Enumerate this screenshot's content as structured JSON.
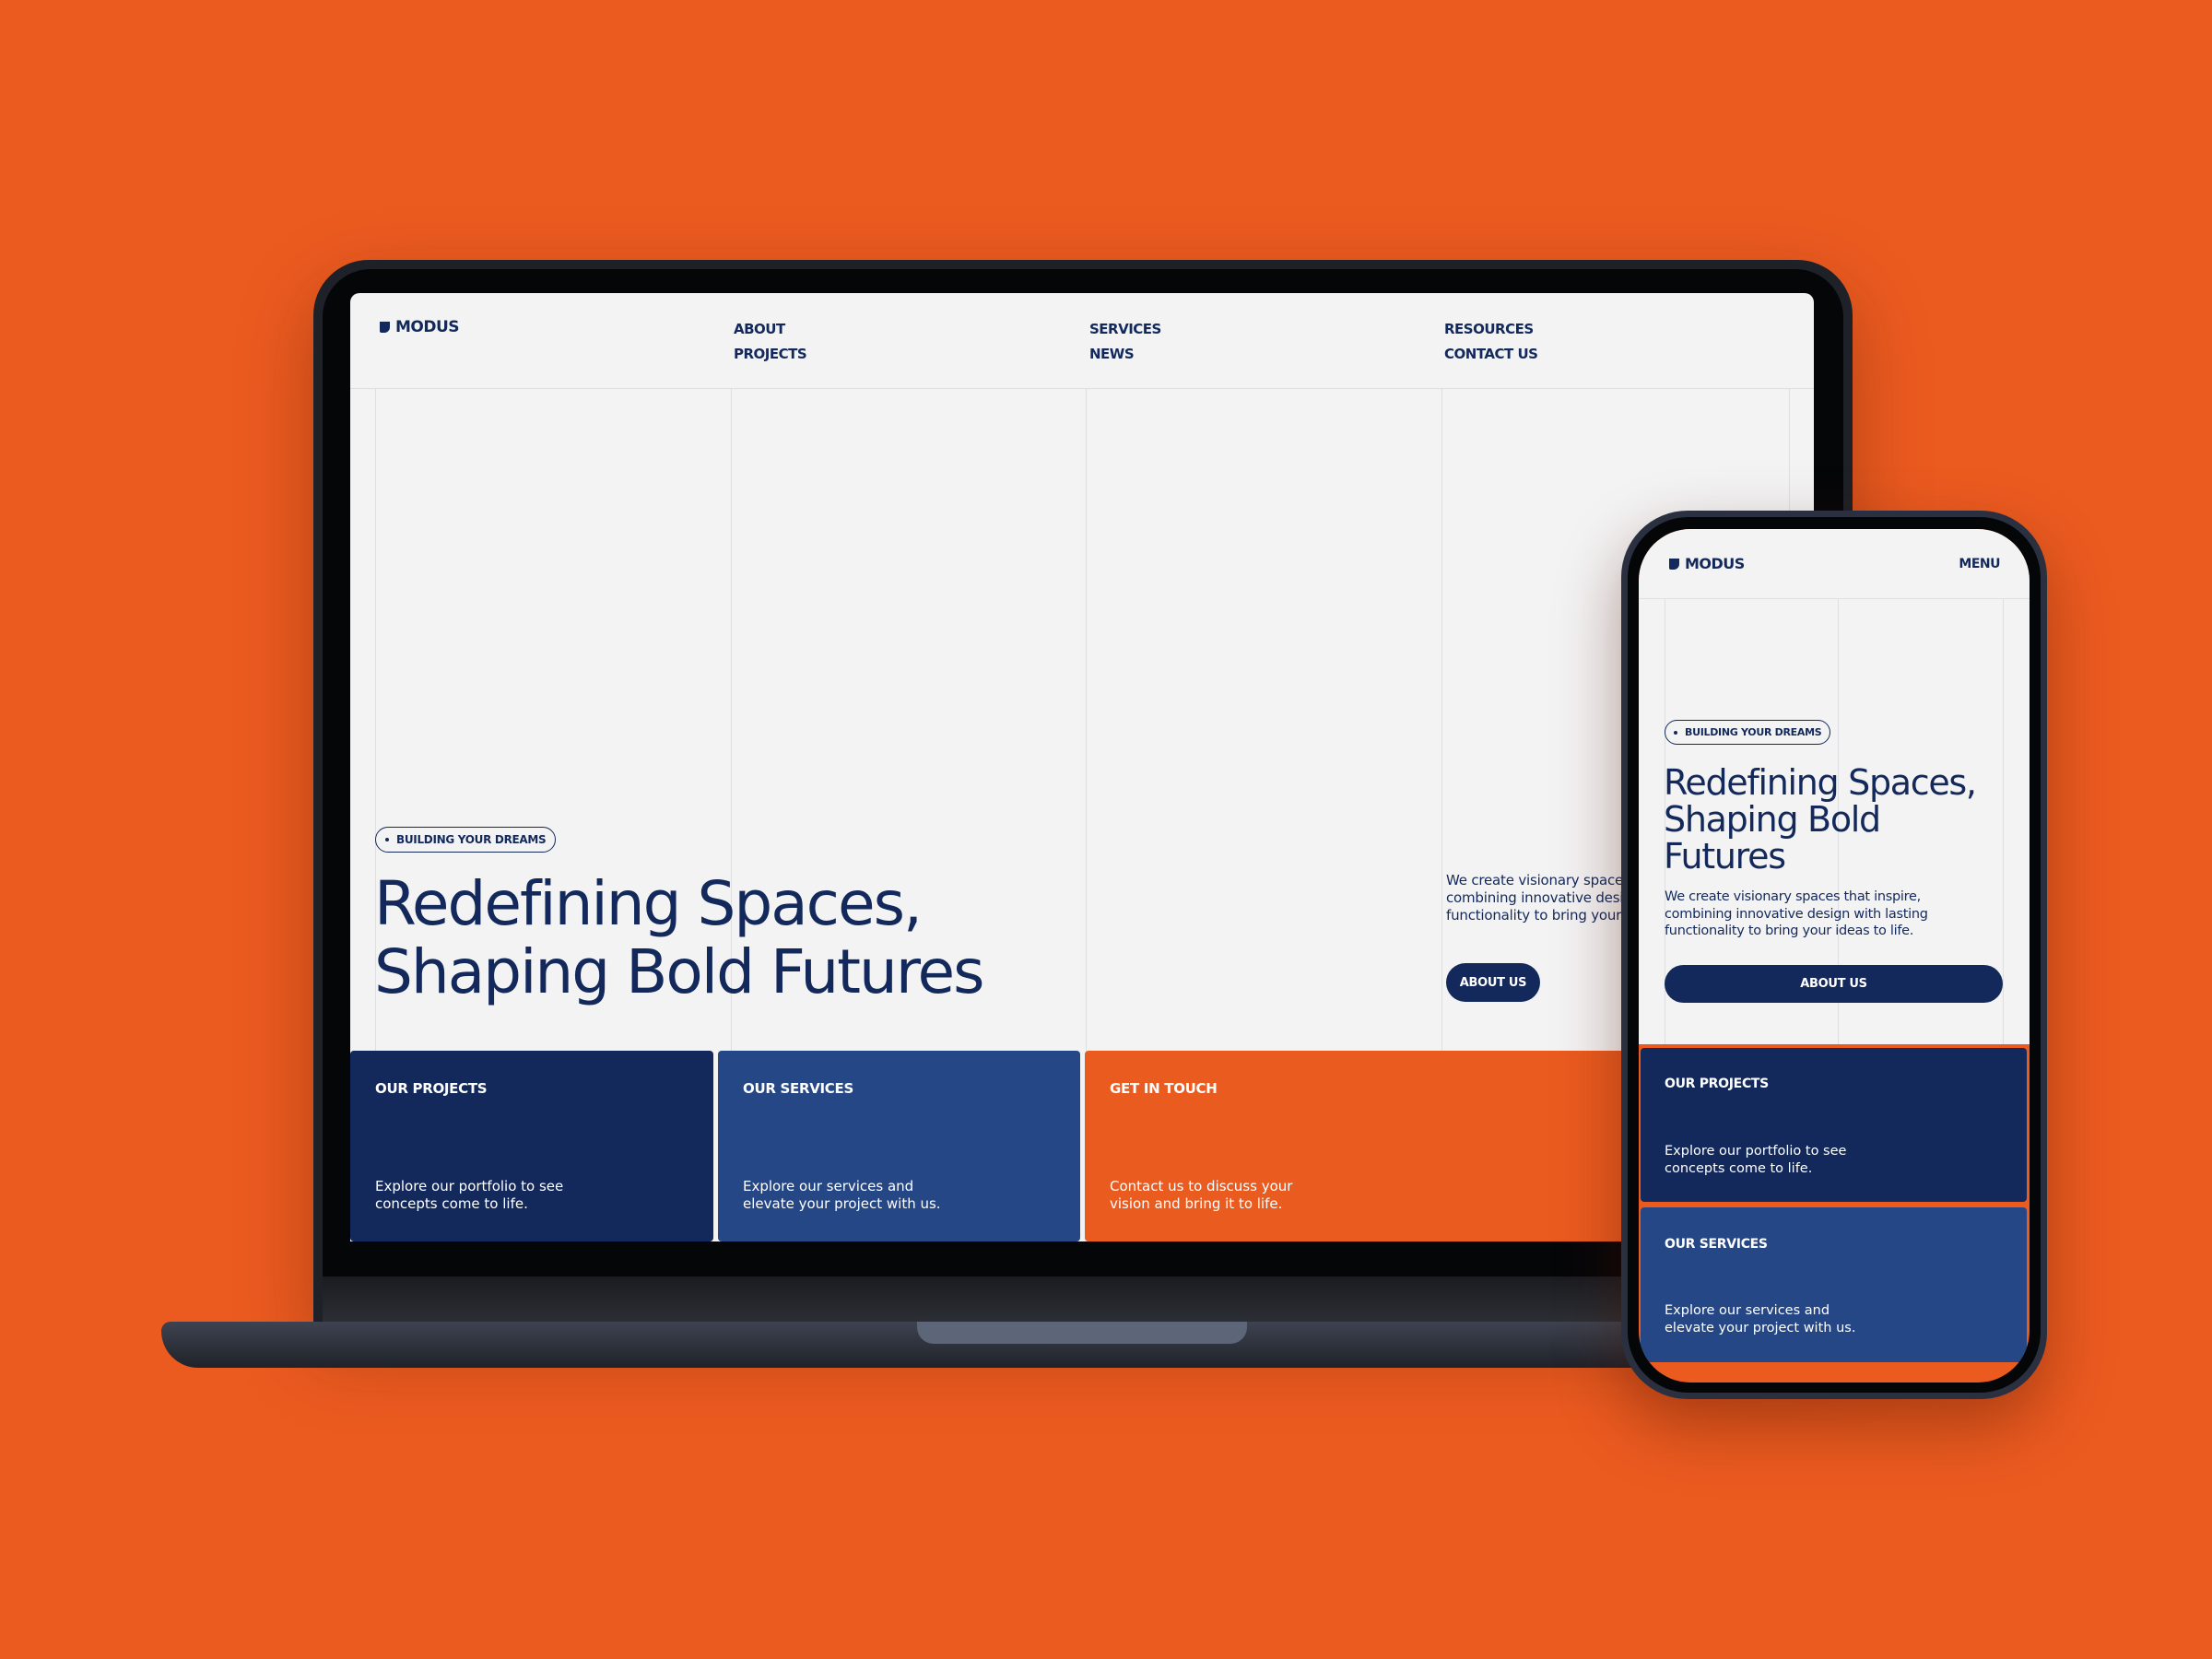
{
  "colors": {
    "background": "#eb5b20",
    "navy": "#13295c",
    "blue": "#264785",
    "orange": "#ea5b1f",
    "surface": "#f3f3f3"
  },
  "brand": {
    "name": "MODUS",
    "icon": "shield-logo-icon"
  },
  "desktop": {
    "nav": [
      {
        "label": "ABOUT"
      },
      {
        "label": "PROJECTS"
      },
      {
        "label": "SERVICES"
      },
      {
        "label": "NEWS"
      },
      {
        "label": "RESOURCES"
      },
      {
        "label": "CONTACT US"
      }
    ],
    "hero": {
      "badge": "BUILDING YOUR DREAMS",
      "title_line1": "Redefining Spaces,",
      "title_line2": "Shaping Bold Futures",
      "description": "We create visionary spaces that inspire, combining innovative design with lasting functionality to bring your ideas to life.",
      "button": "ABOUT US"
    },
    "cards": [
      {
        "title": "OUR PROJECTS",
        "desc_line1": "Explore our portfolio to see",
        "desc_line2": "concepts come to life."
      },
      {
        "title": "OUR SERVICES",
        "desc_line1": "Explore our services and",
        "desc_line2": "elevate your project with us."
      },
      {
        "title": "GET IN TOUCH",
        "desc_line1": "Contact us to discuss your",
        "desc_line2": "vision and bring it to life."
      }
    ]
  },
  "mobile": {
    "menu": "MENU",
    "hero": {
      "badge": "BUILDING YOUR DREAMS",
      "title_line1": "Redefining Spaces,",
      "title_line2": "Shaping Bold",
      "title_line3": "Futures",
      "desc_line1": "We create visionary spaces that inspire,",
      "desc_line2": "combining innovative design with lasting",
      "desc_line3": "functionality to bring your ideas to life.",
      "button": "ABOUT US"
    },
    "cards": [
      {
        "title": "OUR PROJECTS",
        "desc_line1": "Explore our portfolio to see",
        "desc_line2": "concepts come to life."
      },
      {
        "title": "OUR SERVICES",
        "desc_line1": "Explore our services and",
        "desc_line2": "elevate your project with us."
      }
    ]
  }
}
